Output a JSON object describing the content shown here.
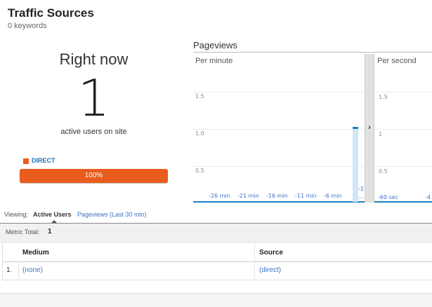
{
  "header": {
    "title": "Traffic Sources",
    "subtitle": "0 keywords"
  },
  "right_now": {
    "label": "Right now",
    "count": "1",
    "caption": "active users on site",
    "legend": {
      "label": "DIRECT",
      "color": "#e85d1d"
    },
    "percent_text": "100%",
    "percent_value": 100
  },
  "pageviews": {
    "title": "Pageviews",
    "per_minute_label": "Per minute",
    "per_second_label": "Per second",
    "divider_icon": "chevron-right-icon",
    "minute_y_ticks": [
      "1.5",
      "1.0",
      "0.5"
    ],
    "minute_x_ticks": [
      "-26 min",
      "-21 min",
      "-16 min",
      "-11 min",
      "-6 min"
    ],
    "minute_last_tick": "-1",
    "minute_ellipsis": "...",
    "second_y_ticks": [
      "1.5",
      "1",
      "0.5"
    ],
    "second_x_ticks": [
      "-60 sec",
      "-4"
    ],
    "accent_color": "#1c7fc4"
  },
  "chart_data": [
    {
      "type": "bar",
      "title": "Per minute",
      "x": [
        "-30",
        "-29",
        "-28",
        "-27",
        "-26",
        "-25",
        "-24",
        "-23",
        "-22",
        "-21",
        "-20",
        "-19",
        "-18",
        "-17",
        "-16",
        "-15",
        "-14",
        "-13",
        "-12",
        "-11",
        "-10",
        "-9",
        "-8",
        "-7",
        "-6",
        "-5",
        "-4",
        "-3",
        "-2",
        "-1"
      ],
      "values": [
        0,
        0,
        0,
        0,
        0,
        0,
        0,
        0,
        0,
        0,
        0,
        0,
        0,
        0,
        0,
        0,
        0,
        0,
        0,
        0,
        0,
        0,
        0,
        0,
        0,
        0,
        0,
        0,
        0,
        1
      ],
      "ylim": [
        0,
        2
      ],
      "grid": true
    },
    {
      "type": "bar",
      "title": "Per second",
      "ylim": [
        0,
        2
      ],
      "grid": true
    }
  ],
  "viewing": {
    "label": "Viewing:",
    "active": "Active Users",
    "other": "Pageviews (Last 30 min)"
  },
  "metric": {
    "label": "Metric Total:",
    "value": "1"
  },
  "table": {
    "headers": {
      "medium": "Medium",
      "source": "Source"
    },
    "rows": [
      {
        "index": "1.",
        "medium": "(none)",
        "source": "(direct)"
      }
    ]
  }
}
